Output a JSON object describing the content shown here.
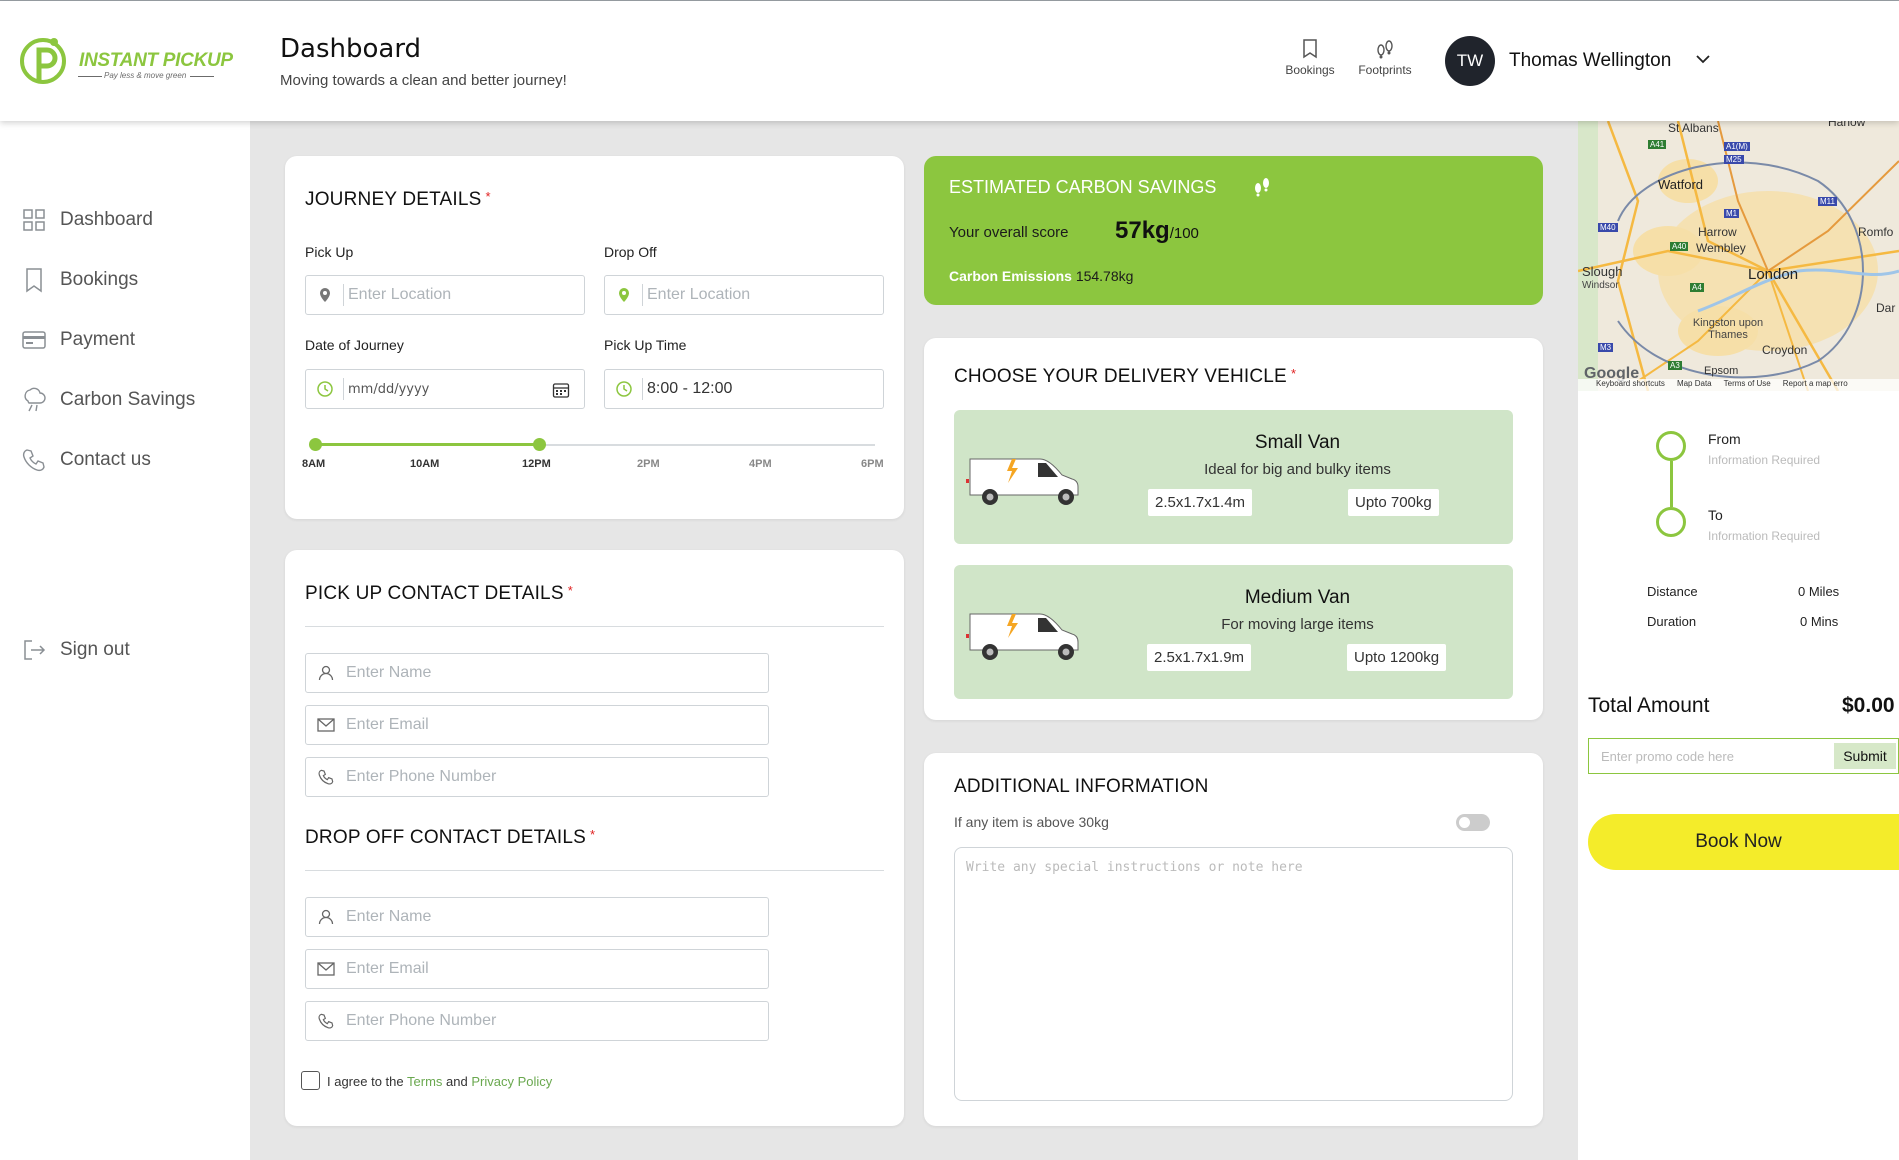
{
  "header": {
    "brand_name": "INSTANT PICKUP",
    "brand_tagline": "Pay less & move green",
    "page_title": "Dashboard",
    "page_subtitle": "Moving towards a clean and better journey!",
    "nav": [
      {
        "label": "Bookings",
        "icon": "bookmark-icon"
      },
      {
        "label": "Footprints",
        "icon": "footprints-icon"
      }
    ],
    "user_initials": "TW",
    "user_name": "Thomas Wellington"
  },
  "sidebar": {
    "items": [
      {
        "label": "Dashboard",
        "icon": "grid-icon"
      },
      {
        "label": "Bookings",
        "icon": "bookmark-icon"
      },
      {
        "label": "Payment",
        "icon": "card-icon"
      },
      {
        "label": "Carbon Savings",
        "icon": "co2-icon"
      },
      {
        "label": "Contact us",
        "icon": "phone-icon"
      }
    ],
    "signout": "Sign out"
  },
  "journey": {
    "title": "JOURNEY DETAILS",
    "required": "*",
    "pickup_label": "Pick Up",
    "pickup_placeholder": "Enter Location",
    "dropoff_label": "Drop Off",
    "dropoff_placeholder": "Enter Location",
    "date_label": "Date of Journey",
    "date_placeholder": "mm/dd/yyyy",
    "time_label": "Pick Up Time",
    "time_value": "8:00 - 12:00",
    "timeline": [
      "8AM",
      "10AM",
      "12PM",
      "2PM",
      "4PM",
      "6PM"
    ],
    "selected_range": [
      "8AM",
      "12PM"
    ]
  },
  "pickup_contact": {
    "title": "PICK UP CONTACT DETAILS",
    "required": "*",
    "name_placeholder": "Enter Name",
    "email_placeholder": "Enter Email",
    "phone_placeholder": "Enter Phone Number"
  },
  "dropoff_contact": {
    "title": "DROP OFF CONTACT DETAILS",
    "required": "*",
    "name_placeholder": "Enter Name",
    "email_placeholder": "Enter Email",
    "phone_placeholder": "Enter Phone Number"
  },
  "agree": {
    "prefix": "I agree to the",
    "terms": "Terms",
    "and": "and",
    "privacy": "Privacy Policy"
  },
  "carbon": {
    "title": "ESTIMATED CARBON SAVINGS",
    "score_label": "Your overall score",
    "score_value": "57kg",
    "score_max": "/100",
    "emissions_label": "Carbon Emissions",
    "emissions_value": "154.78kg",
    "bg_color": "#8cc63f"
  },
  "vehicle": {
    "title": "CHOOSE YOUR DELIVERY VEHICLE",
    "required": "*",
    "options": [
      {
        "name": "Small Van",
        "desc": "Ideal for big and bulky items",
        "size": "2.5x1.7x1.4m",
        "capacity": "Upto 700kg"
      },
      {
        "name": "Medium Van",
        "desc": "For moving large items",
        "size": "2.5x1.7x1.9m",
        "capacity": "Upto 1200kg"
      }
    ]
  },
  "additional": {
    "title": "ADDITIONAL INFORMATION",
    "toggle_label": "If any item is above 30kg",
    "toggle_on": false,
    "notes_placeholder": "Write any special instructions or note here"
  },
  "map": {
    "places": [
      "St Albans",
      "Watford",
      "Harrow",
      "Wembley",
      "London",
      "Slough",
      "Windsor",
      "Kingston upon Thames",
      "Croydon",
      "Epsom",
      "Romfo",
      "Dar",
      "Harlow"
    ],
    "roads": [
      "A41",
      "A1(M)",
      "M25",
      "M1",
      "M40",
      "A40",
      "M11",
      "A4",
      "M3",
      "A3"
    ],
    "footer": [
      "Keyboard shortcuts",
      "Map Data",
      "Terms of Use",
      "Report a map erro"
    ],
    "google": "Google"
  },
  "summary": {
    "from_label": "From",
    "from_hint": "Information Required",
    "to_label": "To",
    "to_hint": "Information Required",
    "distance_label": "Distance",
    "distance_value": "0 Miles",
    "duration_label": "Duration",
    "duration_value": "0 Mins",
    "total_label": "Total Amount",
    "total_value": "$0.00",
    "promo_placeholder": "Enter promo code here",
    "promo_button": "Submit",
    "book_button": "Book Now",
    "book_color": "#f4ec2a"
  }
}
